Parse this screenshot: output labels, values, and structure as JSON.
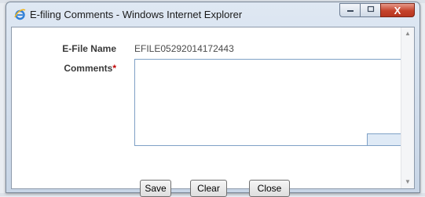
{
  "window": {
    "title": "E-filing Comments - Windows Internet Explorer",
    "controls": {
      "minimize_icon": "minimize-icon",
      "maximize_icon": "maximize-icon",
      "close_label": "X"
    },
    "close_color": "#c4422b"
  },
  "form": {
    "efile_name_label": "E-File Name",
    "efile_name_value": "EFILE05292014172443",
    "comments_label": "Comments",
    "required_marker": "*",
    "comments_value": ""
  },
  "buttons": {
    "save": "Save",
    "clear": "Clear",
    "close": "Close"
  }
}
